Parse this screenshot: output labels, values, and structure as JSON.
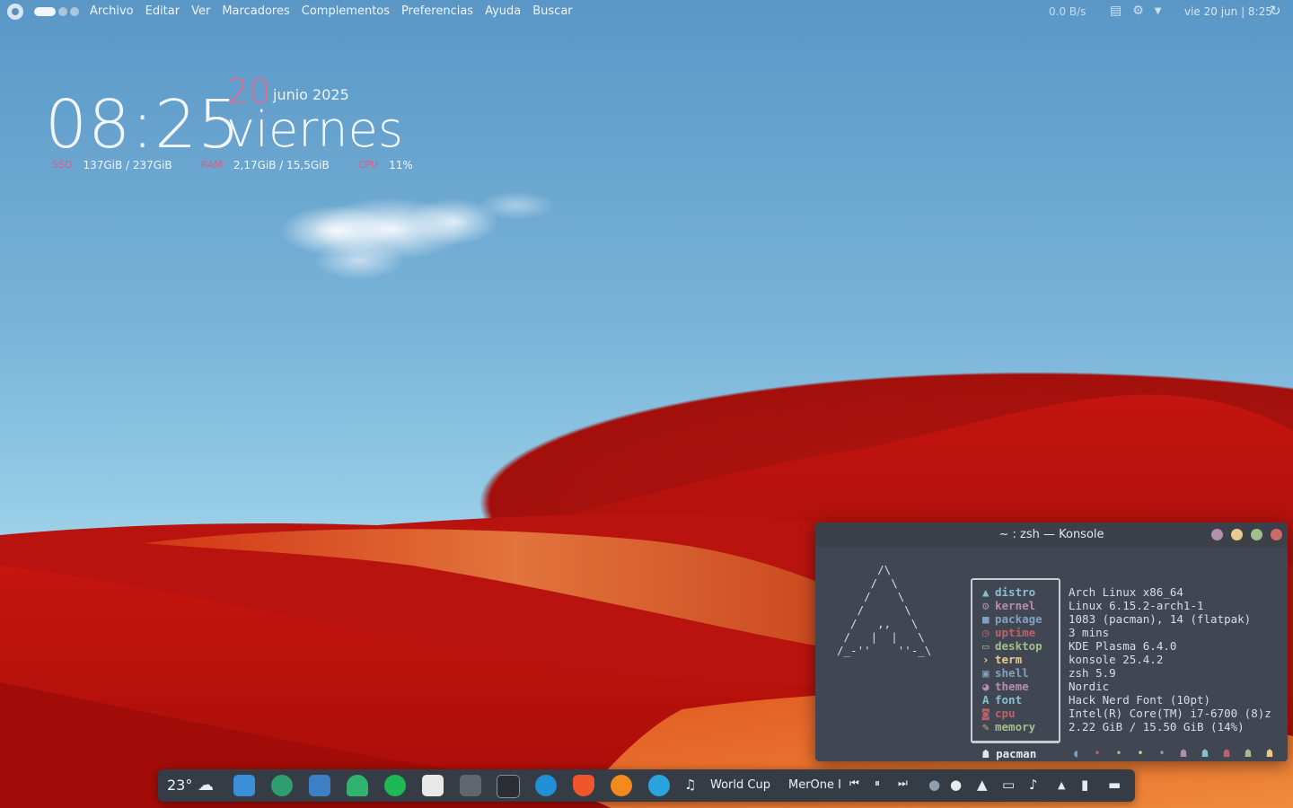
{
  "topbar": {
    "menus": [
      "Archivo",
      "Editar",
      "Ver",
      "Marcadores",
      "Complementos",
      "Preferencias",
      "Ayuda",
      "Buscar"
    ],
    "net_speed": "0.0 B/s",
    "clock": "vie 20 jun | 8:25"
  },
  "widget": {
    "time": "08:25",
    "day": "20",
    "month_year": "junio 2025",
    "weekday": "viernes",
    "stats": [
      {
        "label": "SSD",
        "value": "137GiB / 237GiB"
      },
      {
        "label": "RAM",
        "value": "2,17GiB / 15,5GiB"
      },
      {
        "label": "CPU",
        "value": "11%"
      }
    ]
  },
  "konsole": {
    "title": "~ : zsh — Konsole",
    "ascii": "      /\\\n     /  \\\n    /    \\\n   /      \\\n  /   ,,   \\\n /   |  |   \\\n/_-''    ''-_\\",
    "fetch": [
      {
        "label": "distro",
        "icon": "arch-icon",
        "color": "#88c0d0",
        "value": "Arch Linux x86_64"
      },
      {
        "label": "kernel",
        "icon": "gear-icon",
        "color": "#b48ead",
        "value": "Linux 6.15.2-arch1-1"
      },
      {
        "label": "package",
        "icon": "package-icon",
        "color": "#81a1c1",
        "value": "1083 (pacman), 14 (flatpak)"
      },
      {
        "label": "uptime",
        "icon": "clock-icon",
        "color": "#bf616a",
        "value": "3 mins"
      },
      {
        "label": "desktop",
        "icon": "monitor-icon",
        "color": "#a3be8c",
        "value": "KDE Plasma 6.4.0"
      },
      {
        "label": "term",
        "icon": "terminal-icon",
        "color": "#ebcb8b",
        "value": "konsole 25.4.2"
      },
      {
        "label": "shell",
        "icon": "shell-icon",
        "color": "#81a1c1",
        "value": "zsh 5.9"
      },
      {
        "label": "theme",
        "icon": "palette-icon",
        "color": "#b48ead",
        "value": "Nordic"
      },
      {
        "label": "font",
        "icon": "font-icon",
        "color": "#88c0d0",
        "value": "Hack Nerd Font (10pt)"
      },
      {
        "label": "cpu",
        "icon": "chip-icon",
        "color": "#bf616a",
        "value": "Intel(R) Core(TM) i7-6700 (8)z"
      },
      {
        "label": "memory",
        "icon": "pencil-icon",
        "color": "#a3be8c",
        "value": "2.22 GiB / 15.50 GiB (14%)"
      }
    ],
    "pacman_label": "pacman",
    "colors": {
      "close": "#e06c75",
      "maximize": "#98c379",
      "minimize": "#e5c07b",
      "pin": "#c678dd"
    }
  },
  "dock": {
    "temperature": "23°",
    "weather_icon": "cloud-icon",
    "media_title": "World Cup",
    "media_artist": "MerOne I"
  }
}
